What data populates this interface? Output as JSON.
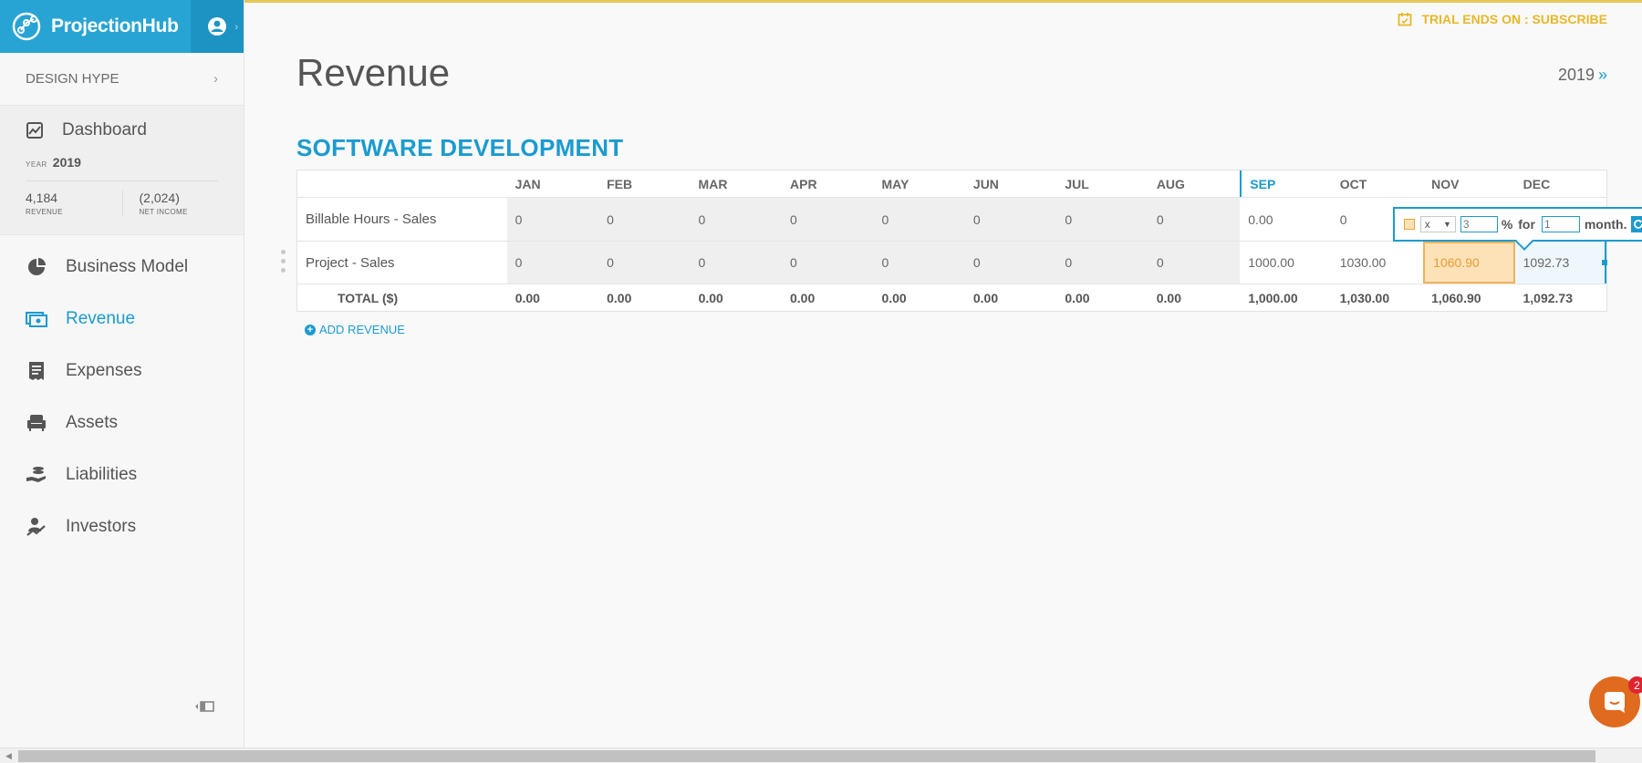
{
  "app": {
    "name": "ProjectionHub"
  },
  "sidebar": {
    "company": "DESIGN HYPE",
    "dashboard": {
      "label": "Dashboard",
      "year_label": "YEAR",
      "year": "2019",
      "revenue_value": "4,184",
      "revenue_label": "REVENUE",
      "net_income_value": "(2,024)",
      "net_income_label": "NET INCOME"
    },
    "items": [
      {
        "label": "Business Model",
        "icon": "pie-chart-icon"
      },
      {
        "label": "Revenue",
        "icon": "cash-icon",
        "active": true
      },
      {
        "label": "Expenses",
        "icon": "receipt-icon"
      },
      {
        "label": "Assets",
        "icon": "armchair-icon"
      },
      {
        "label": "Liabilities",
        "icon": "hand-coins-icon"
      },
      {
        "label": "Investors",
        "icon": "investor-icon"
      }
    ]
  },
  "header": {
    "trial_text": "TRIAL ENDS ON : SUBSCRIBE",
    "page_title": "Revenue",
    "year": "2019",
    "year_arrow": "»"
  },
  "section": {
    "title": "SOFTWARE DEVELOPMENT"
  },
  "table": {
    "months": [
      "JAN",
      "FEB",
      "MAR",
      "APR",
      "MAY",
      "JUN",
      "JUL",
      "AUG",
      "SEP",
      "OCT",
      "NOV",
      "DEC"
    ],
    "rows": [
      {
        "name": "Billable Hours - Sales",
        "values": [
          "0",
          "0",
          "0",
          "0",
          "0",
          "0",
          "0",
          "0",
          "0.00",
          "0",
          "",
          ""
        ]
      },
      {
        "name": "Project - Sales",
        "values": [
          "0",
          "0",
          "0",
          "0",
          "0",
          "0",
          "0",
          "0",
          "1000.00",
          "1030.00",
          "1060.90",
          "1092.73"
        ]
      }
    ],
    "total": {
      "name": "TOTAL ($)",
      "values": [
        "0.00",
        "0.00",
        "0.00",
        "0.00",
        "0.00",
        "0.00",
        "0.00",
        "0.00",
        "1,000.00",
        "1,030.00",
        "1,060.90",
        "1,092.73"
      ]
    }
  },
  "growth_popup": {
    "operator": "x",
    "percent_value": "3",
    "percent_sign": "%",
    "for_label": "for",
    "months_value": "1",
    "months_label": "month."
  },
  "add_revenue": "ADD REVENUE",
  "chat": {
    "badge": "2"
  },
  "colors": {
    "accent": "#1b9bcf",
    "brand": "#27a4d3",
    "trial": "#e7b729",
    "highlight": "#fde2b8",
    "chat": "#e06a1e"
  }
}
